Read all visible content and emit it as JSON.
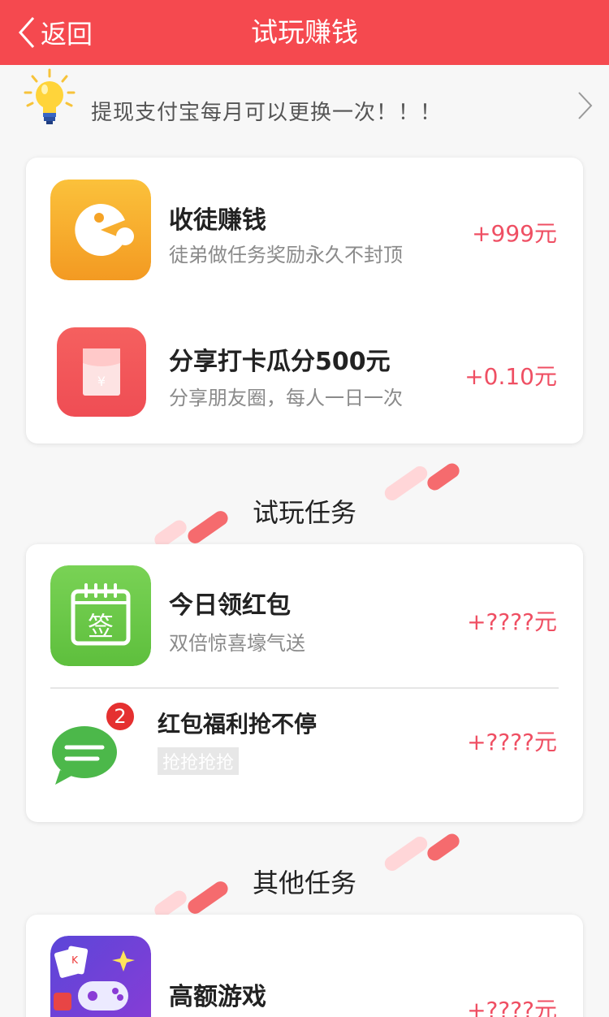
{
  "header": {
    "back_label": "返回",
    "title": "试玩赚钱",
    "bg_color": "#f5494f"
  },
  "notice": {
    "text": "提现支付宝每月可以更换一次！！！",
    "icon": "lightbulb-icon"
  },
  "featured_tasks": [
    {
      "name": "收徒赚钱",
      "desc": "徒弟做任务奖励永久不封顶",
      "reward": "+999元",
      "icon": "pacman-icon"
    },
    {
      "name": "分享打卡瓜分500元",
      "desc": "分享朋友圈，每人一日一次",
      "reward": "+0.10元",
      "icon": "red-envelope-icon"
    }
  ],
  "trial_section": {
    "title": "试玩任务",
    "tasks": [
      {
        "name": "今日领红包",
        "desc": "双倍惊喜壕气送",
        "reward": "+????元",
        "icon": "sign-in-calendar-icon",
        "icon_text": "签"
      },
      {
        "name": "红包福利抢不停",
        "tag": "抢抢抢抢",
        "reward": "+????元",
        "icon": "chat-bubble-icon",
        "badge": "2"
      }
    ]
  },
  "other_section": {
    "title": "其他任务",
    "tasks": [
      {
        "name": "高额游戏",
        "reward": "+????元",
        "icon": "game-controller-icon"
      }
    ]
  },
  "colors": {
    "accent": "#f5494f",
    "reward": "#ef4f63",
    "sub_text": "#8a8a8a"
  }
}
